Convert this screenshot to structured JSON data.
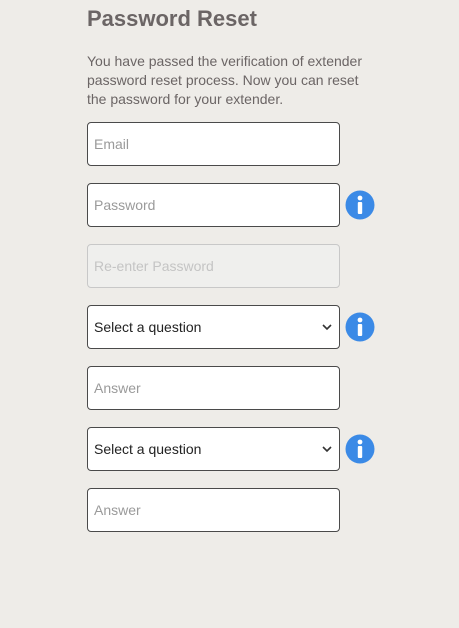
{
  "page": {
    "title": "Password Reset",
    "description": "You have passed the verification of extender password reset process. Now you can reset the password for your extender."
  },
  "form": {
    "email_placeholder": "Email",
    "password_placeholder": "Password",
    "reenter_password_placeholder": "Re-enter Password",
    "question1_selected": "Select a question",
    "answer1_placeholder": "Answer",
    "question2_selected": "Select a question",
    "answer2_placeholder": "Answer"
  },
  "icons": {
    "info": "info-icon",
    "dropdown": "chevron-down-icon"
  },
  "colors": {
    "background": "#eeece8",
    "title": "#6b6565",
    "info_icon": "#3b8ae6",
    "field_border": "#4a4a4a"
  }
}
